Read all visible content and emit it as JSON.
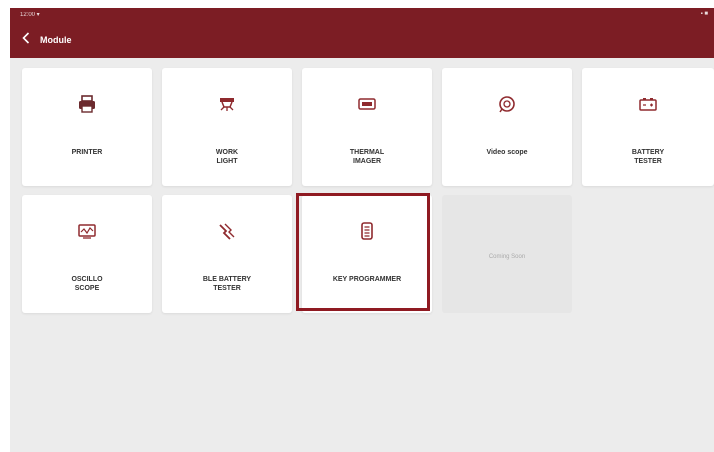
{
  "status_bar": {
    "time": "12:00 ▾",
    "right": "▪ ■"
  },
  "header": {
    "title": "Module",
    "back_icon": "chevron-left-icon"
  },
  "colors": {
    "header_bg": "#7c1d24",
    "highlight": "#8f1a22",
    "icon_color": "#8f2a2e"
  },
  "modules": [
    {
      "label": "PRINTER",
      "icon": "printer-icon"
    },
    {
      "label": "WORK\nLIGHT",
      "icon": "work-light-icon"
    },
    {
      "label": "THERMAL\nIMAGER",
      "icon": "thermal-imager-icon"
    },
    {
      "label": "Video scope",
      "icon": "videoscope-icon"
    },
    {
      "label": "BATTERY\nTESTER",
      "icon": "battery-icon"
    },
    {
      "label": "OSCILLO\nSCOPE",
      "icon": "oscilloscope-icon"
    },
    {
      "label": "BLE BATTERY\nTESTER",
      "icon": "ble-battery-icon"
    },
    {
      "label": "KEY PROGRAMMER",
      "icon": "key-programmer-icon",
      "highlighted": true
    },
    {
      "label": "Coming Soon",
      "icon": "",
      "disabled": true
    }
  ]
}
